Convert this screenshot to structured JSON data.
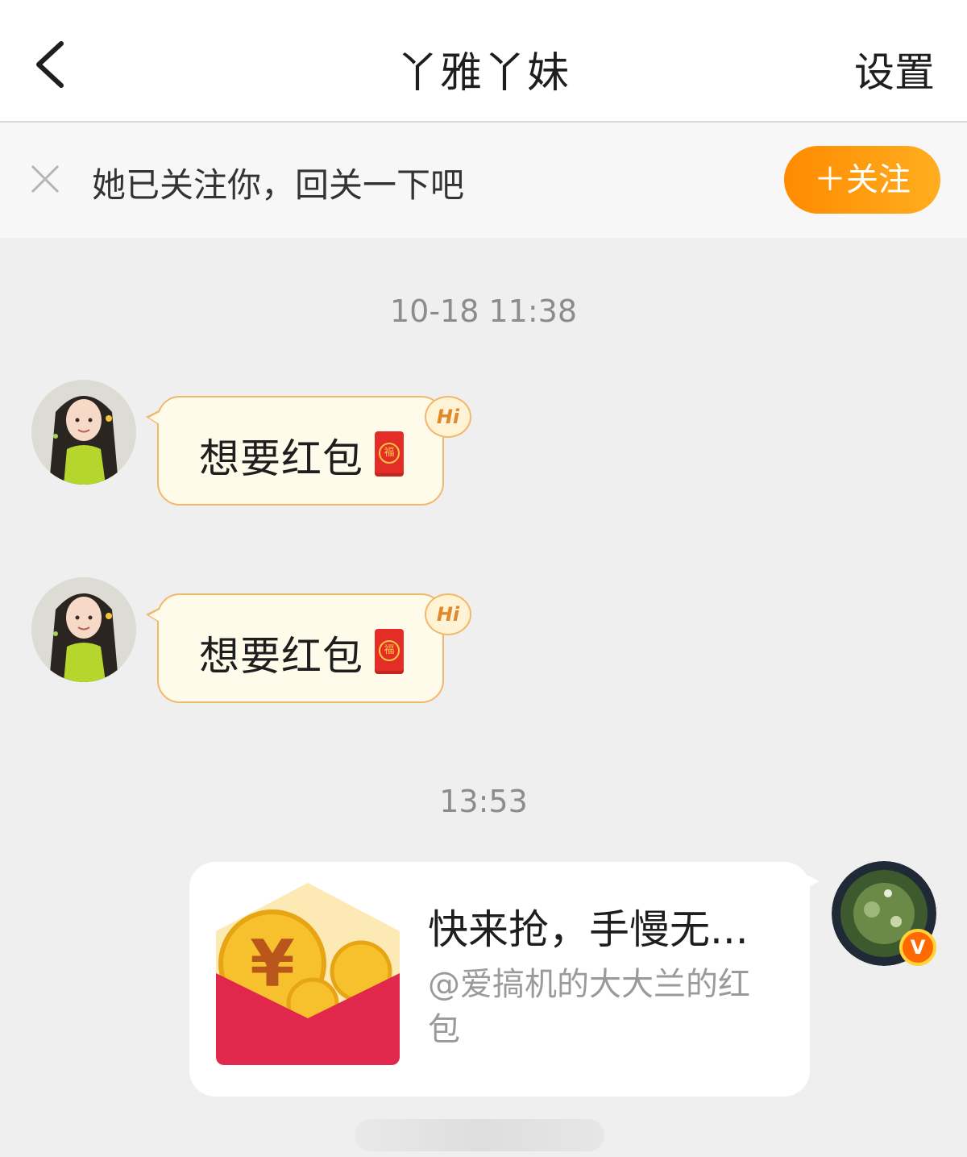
{
  "header": {
    "title": "丫雅丫妹",
    "settings_label": "设置",
    "back_icon": "chevron-left-icon"
  },
  "follow_bar": {
    "message": "她已关注你，回关一下吧",
    "button_label": "＋关注",
    "close_icon": "close-icon",
    "accent_color": "#ff9500"
  },
  "messages": {
    "time1": "10-18 11:38",
    "bubble1": {
      "text": "想要红包",
      "badge": "Hi",
      "emoji": "red-envelope-emoji"
    },
    "bubble2": {
      "text": "想要红包",
      "badge": "Hi",
      "emoji": "red-envelope-emoji"
    },
    "time2": "13:53",
    "card": {
      "title": "快来抢，手慢无...",
      "subtitle": "@爱搞机的大大兰的红包",
      "icon": "red-envelope-icon"
    },
    "verified_badge": "V"
  }
}
